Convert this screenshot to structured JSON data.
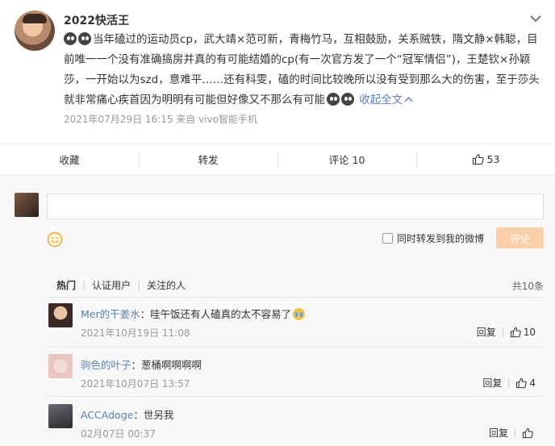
{
  "post": {
    "username": "2022快活王",
    "text_before_emoji": "当年磕过的运动员cp，武大靖×范可新，青梅竹马，互相鼓励，关系贼铁，隋文静×韩聪，目前唯一一个没有准确搞房并真的有可能结婚的cp(有一次官方发了一个“冠军情侣”)，王楚钦×孙颖莎，一开始以为szd，意难平……还有科雯，磕的时间比较晚所以没有受到那么大的伤害，至于莎头就非常痛心疾首因为明明有可能但好像又不那么有可能",
    "collapse_label": "收起全文",
    "meta": "2021年07月29日 16:15  来自 vivo智能手机"
  },
  "actions": {
    "favorite": "收藏",
    "repost": "转发",
    "comment": "评论 10",
    "like_count": "53"
  },
  "composer": {
    "placeholder": "",
    "repost_label": "同时转发到我的微博",
    "submit_label": "评论"
  },
  "comments_section": {
    "tabs": [
      "热门",
      "认证用户",
      "关注的人"
    ],
    "total": "共10条",
    "items": [
      {
        "nick": "Mer的干姜水",
        "text": "：哇午饭还有人磕真的太不容易了",
        "time": "2021年10月19日 11:08",
        "reply": "回复",
        "likes": "10"
      },
      {
        "nick": "驹色的叶子",
        "text": "：葱桶啊啊啊啊",
        "time": "2021年10月07日 13:57",
        "reply": "回复",
        "likes": "4"
      },
      {
        "nick": "ACCAdoge",
        "text": "：世另我",
        "time": "02月07日 00:37",
        "reply": "回复",
        "likes": ""
      }
    ]
  },
  "colors": {
    "link": "#5b7fb3",
    "submit_disabled": "#fbcfa9",
    "meta_gray": "#999999"
  }
}
